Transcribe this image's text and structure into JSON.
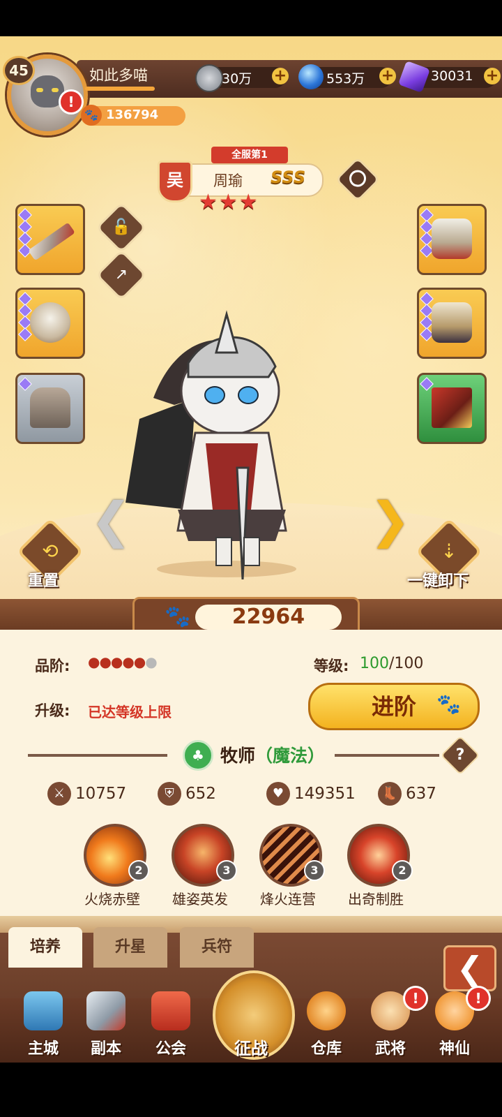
{
  "player": {
    "level": "45",
    "name": "如此多喵",
    "power": "136794",
    "alert": "!"
  },
  "resources": [
    {
      "icon": "copper-coin-icon",
      "value": "30万"
    },
    {
      "icon": "blue-orb-icon",
      "value": "553万"
    },
    {
      "icon": "purple-gem-icon",
      "value": "30031"
    }
  ],
  "hero": {
    "rank_tag": "全服第1",
    "kingdom": "吴",
    "name": "周瑜",
    "grade": "SSS",
    "stars": "★★★",
    "star_count": 3,
    "combat_power": "22964",
    "quality_label": "品阶:",
    "quality_filled": "●●●●●",
    "quality_empty": "●",
    "quality_level": 5,
    "quality_max": 6,
    "level_label": "等级:",
    "level_current": "100",
    "level_max": "/100",
    "upgrade_label": "升级:",
    "upgrade_status": "已达等级上限",
    "advance_button": "进阶",
    "class_name": "牧师",
    "class_type": "（魔法）",
    "help": "?",
    "stats": [
      {
        "icon": "sword-icon",
        "value": "10757"
      },
      {
        "icon": "shield-icon",
        "value": "652"
      },
      {
        "icon": "heart-icon",
        "value": "149351"
      },
      {
        "icon": "boot-icon",
        "value": "637"
      }
    ],
    "skills": [
      {
        "name": "火烧赤壁",
        "level": "2",
        "color": "#f07a1c"
      },
      {
        "name": "雄姿英发",
        "level": "3",
        "color": "#c84426"
      },
      {
        "name": "烽火连营",
        "level": "3",
        "color": "#8a2a16"
      },
      {
        "name": "出奇制胜",
        "level": "2",
        "color": "#d8442a"
      }
    ]
  },
  "actions": {
    "reset_label": "重置",
    "unequip_label": "一键卸下",
    "reset_icon": "⟲",
    "unequip_icon": "⇣"
  },
  "tabs": [
    "培养",
    "升星",
    "兵符"
  ],
  "back_icon": "❮",
  "nav": [
    {
      "label": "主城",
      "color": "#4ba6d8"
    },
    {
      "label": "副本",
      "color": "#c9cfd6"
    },
    {
      "label": "公会",
      "color": "#d94a33"
    },
    {
      "label": "征战",
      "color": "#f3b33a"
    },
    {
      "label": "仓库",
      "color": "#f0a23a"
    },
    {
      "label": "武将",
      "color": "#f2c07a"
    },
    {
      "label": "神仙",
      "color": "#f19a3a"
    }
  ]
}
